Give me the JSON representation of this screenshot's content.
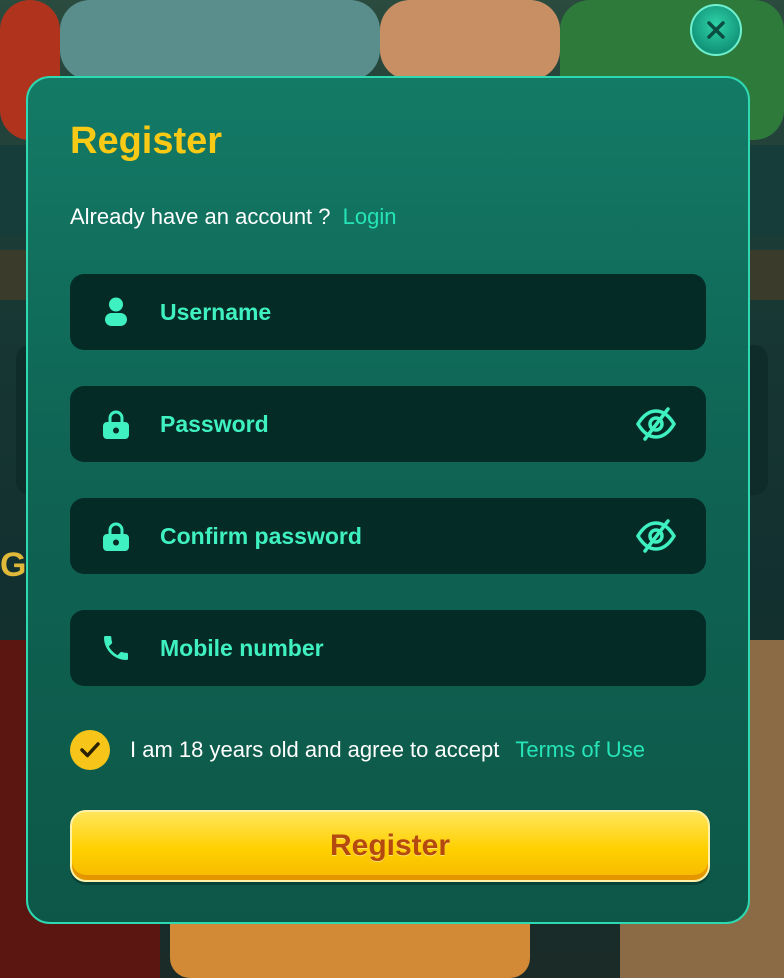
{
  "background": {
    "edge_letter": "G"
  },
  "modal": {
    "title": "Register",
    "account_prompt": "Already have an account ?",
    "login_link": "Login",
    "fields": {
      "username": {
        "placeholder": "Username",
        "value": "",
        "icon": "user-icon"
      },
      "password": {
        "placeholder": "Password",
        "value": "",
        "icon": "lock-icon",
        "toggle_icon": "eye-off-icon"
      },
      "confirm_password": {
        "placeholder": "Confirm password",
        "value": "",
        "icon": "lock-icon",
        "toggle_icon": "eye-off-icon"
      },
      "mobile": {
        "placeholder": "Mobile number",
        "value": "",
        "icon": "phone-icon"
      }
    },
    "agree": {
      "checked": true,
      "text": "I am 18 years old and agree to accept",
      "terms_link": "Terms of Use"
    },
    "submit_label": "Register"
  },
  "colors": {
    "accent_yellow": "#f8c915",
    "accent_teal": "#26e4b7",
    "field_bg": "#052b26",
    "modal_bg": "#0f6454"
  }
}
